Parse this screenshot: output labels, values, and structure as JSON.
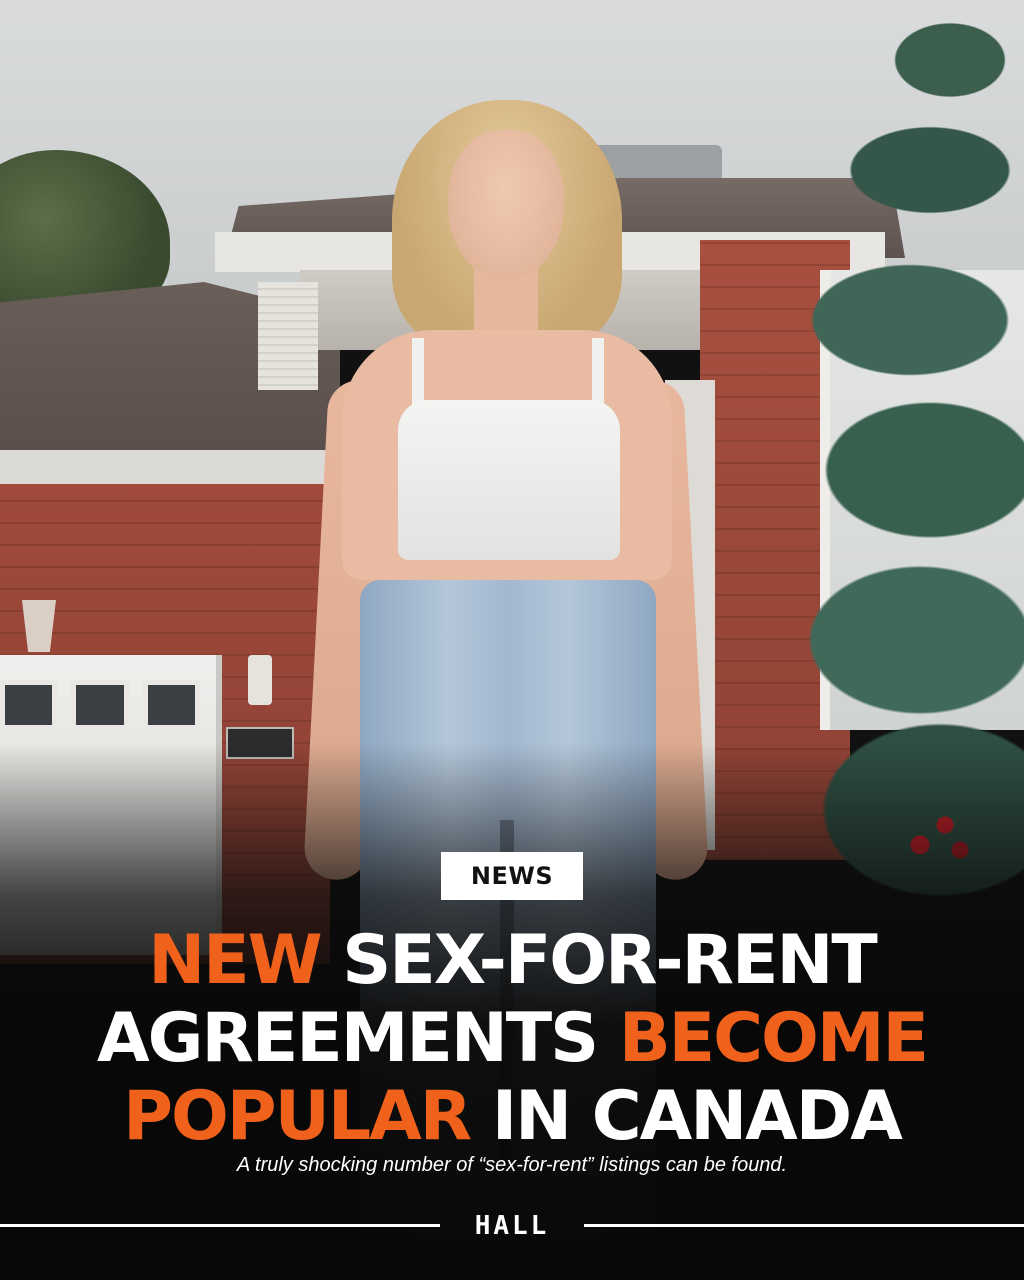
{
  "badge": {
    "label": "NEWS"
  },
  "headline": {
    "line1": {
      "accent": "NEW",
      "rest": " SEX-FOR-RENT"
    },
    "line2": {
      "rest": "AGREEMENTS ",
      "accent": "BECOME"
    },
    "line3": {
      "accent": "POPULAR",
      "rest": " IN CANADA"
    }
  },
  "subtitle": "A truly shocking number of “sex-for-rent” listings can be found.",
  "brand": {
    "logo_text": "HALL"
  },
  "colors": {
    "accent": "#f0611c",
    "text": "#ffffff",
    "badge_bg": "#ffffff",
    "background_dark": "#080808"
  }
}
